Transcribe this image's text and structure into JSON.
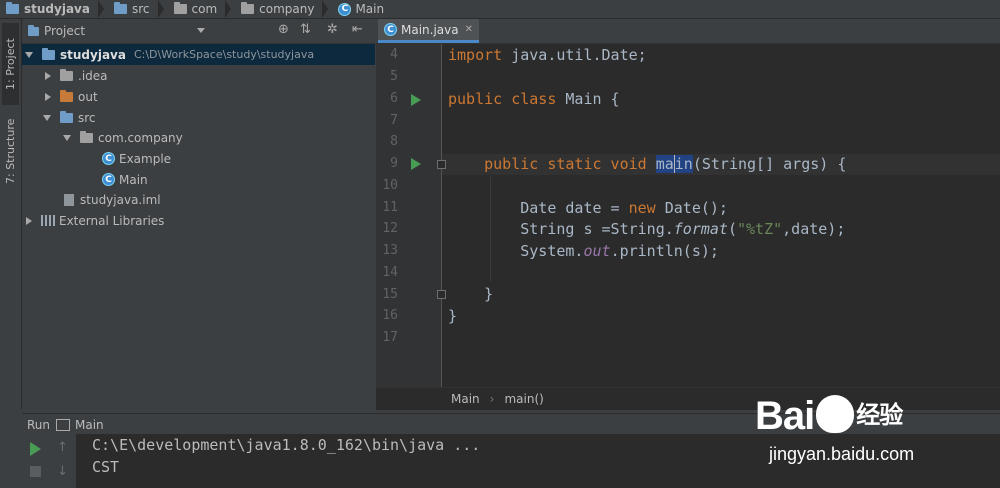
{
  "breadcrumb": [
    "studyjava",
    "src",
    "com",
    "company",
    "Main"
  ],
  "project_panel": {
    "title": "Project",
    "side_tabs": [
      "1: Project",
      "7: Structure"
    ],
    "tree": [
      {
        "label": "studyjava",
        "path": "C:\\D\\WorkSpace\\study\\studyjava",
        "level": 0,
        "expanded": true,
        "icon": "module-folder-icon",
        "selected": true
      },
      {
        "label": ".idea",
        "level": 1,
        "expanded": false,
        "icon": "folder-icon"
      },
      {
        "label": "out",
        "level": 1,
        "expanded": false,
        "icon": "excluded-folder-icon"
      },
      {
        "label": "src",
        "level": 1,
        "expanded": true,
        "icon": "source-folder-icon"
      },
      {
        "label": "com.company",
        "level": 2,
        "expanded": true,
        "icon": "package-icon"
      },
      {
        "label": "Example",
        "level": 3,
        "icon": "class-icon"
      },
      {
        "label": "Main",
        "level": 3,
        "icon": "class-icon"
      },
      {
        "label": "studyjava.iml",
        "level": 1,
        "icon": "iml-file-icon"
      },
      {
        "label": "External Libraries",
        "level": 0,
        "expanded": false,
        "icon": "library-icon"
      }
    ]
  },
  "editor": {
    "tab": "Main.java",
    "line_numbers": [
      "4",
      "5",
      "6",
      "7",
      "8",
      "9",
      "10",
      "11",
      "12",
      "13",
      "14",
      "15",
      "16",
      "17"
    ],
    "breadcrumb": [
      "Main",
      "main()"
    ]
  },
  "run_panel": {
    "label": "Run",
    "config": "Main",
    "output": [
      "C:\\E\\development\\java1.8.0_162\\bin\\java ...",
      "CST"
    ]
  },
  "watermark": {
    "brand": "Bai",
    "brand2": "经验",
    "url": "jingyan.baidu.com"
  },
  "colors": {
    "accent": "#4a88c7",
    "run_green": "#499c54",
    "keyword": "#cc7832",
    "string": "#6a8759"
  }
}
